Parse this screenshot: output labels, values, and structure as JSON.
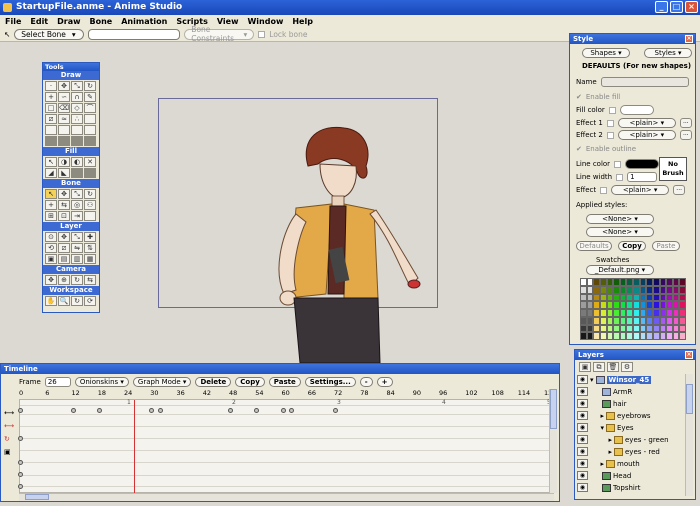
{
  "window": {
    "title": "StartupFile.anme - Anime Studio"
  },
  "menu": [
    "File",
    "Edit",
    "Draw",
    "Bone",
    "Animation",
    "Scripts",
    "View",
    "Window",
    "Help"
  ],
  "toolbar": {
    "tool": "Select Bone",
    "constraints": "Bone Constraints",
    "lock": "Lock bone"
  },
  "tools": {
    "title": "Tools",
    "sections": [
      "Draw",
      "Fill",
      "Bone",
      "Layer",
      "Camera",
      "Workspace"
    ]
  },
  "style": {
    "title": "Style",
    "shapes_btn": "Shapes",
    "styles_btn": "Styles",
    "defaults_heading": "DEFAULTS (For new shapes)",
    "name_label": "Name",
    "enable_fill": "Enable fill",
    "fill_color": "Fill color",
    "effect1_label": "Effect 1",
    "effect1_value": "<plain>",
    "effect2_label": "Effect 2",
    "effect2_value": "<plain>",
    "enable_outline": "Enable outline",
    "line_color": "Line color",
    "line_width": "Line width",
    "line_width_value": "1",
    "no_brush": "No Brush",
    "effect_label": "Effect",
    "effect_value": "<plain>",
    "applied_styles": "Applied styles:",
    "applied1": "<None>",
    "applied2": "<None>",
    "defaults_btn": "Defaults",
    "copy_btn": "Copy",
    "paste_btn": "Paste",
    "swatches_label": "Swatches",
    "swatches_file": "_Default.png",
    "more": "..."
  },
  "layers": {
    "title": "Layers",
    "items": [
      {
        "name": "Winsor_45",
        "type": "bone"
      },
      {
        "name": "ArmR",
        "type": "bone"
      },
      {
        "name": "hair",
        "type": "img"
      },
      {
        "name": "eyebrows",
        "type": "group"
      },
      {
        "name": "Eyes",
        "type": "group"
      },
      {
        "name": "eyes - green",
        "type": "group"
      },
      {
        "name": "eyes - red",
        "type": "group"
      },
      {
        "name": "mouth",
        "type": "group"
      },
      {
        "name": "Head",
        "type": "img"
      },
      {
        "name": "Topshirt",
        "type": "img"
      }
    ]
  },
  "timeline": {
    "title": "Timeline",
    "frame_label": "Frame",
    "frame_value": "26",
    "onionskins": "Onionskins",
    "graph_mode": "Graph Mode",
    "delete": "Delete",
    "copy": "Copy",
    "paste": "Paste",
    "settings": "Settings...",
    "minus": "-",
    "plus": "+",
    "ruler": [
      "0",
      "6",
      "12",
      "18",
      "24",
      "30",
      "36",
      "42",
      "48",
      "54",
      "60",
      "66",
      "72",
      "78",
      "84",
      "90",
      "96",
      "102",
      "108",
      "114",
      "120"
    ],
    "seconds": [
      "1",
      "2",
      "3",
      "4",
      "5"
    ]
  },
  "colors": {
    "accent": "#2155c4",
    "selection": "#3b67c6",
    "cursor": "#d33333"
  }
}
